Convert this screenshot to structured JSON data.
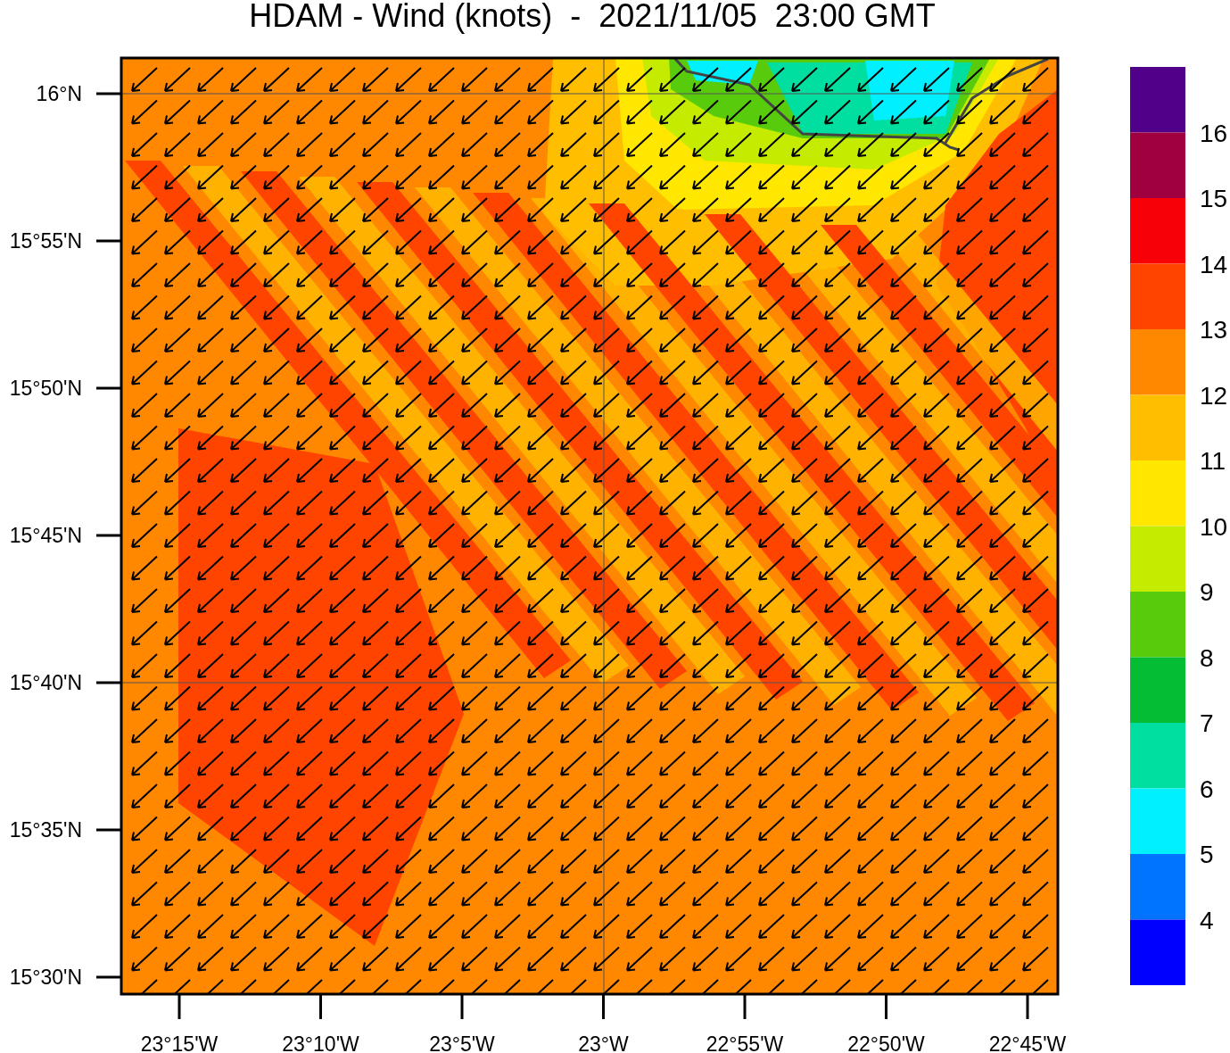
{
  "title": "HDAM - Wind (knots)  -  2021/11/05  23:00 GMT",
  "y_axis": {
    "ticks": [
      "16°N",
      "15°55'N",
      "15°50'N",
      "15°45'N",
      "15°40'N",
      "15°35'N",
      "15°30'N"
    ]
  },
  "x_axis": {
    "ticks": [
      "23°15'W",
      "23°10'W",
      "23°5'W",
      "23°W",
      "22°55'W",
      "22°50'W",
      "22°45'W"
    ]
  },
  "colorbar": {
    "swatches": [
      {
        "color": "#51008a"
      },
      {
        "color": "#a00040"
      },
      {
        "color": "#f70007"
      },
      {
        "color": "#ff4400"
      },
      {
        "color": "#ff8800"
      },
      {
        "color": "#ffbe00"
      },
      {
        "color": "#ffe700"
      },
      {
        "color": "#c5ec00"
      },
      {
        "color": "#58cc0c"
      },
      {
        "color": "#05bd35"
      },
      {
        "color": "#00dfa0"
      },
      {
        "color": "#00f0ff"
      },
      {
        "color": "#0073ff"
      },
      {
        "color": "#0000ff"
      }
    ],
    "labels": [
      "16",
      "15",
      "14",
      "13",
      "12",
      "11",
      "10",
      "9",
      "8",
      "7",
      "6",
      "5",
      "4"
    ]
  }
}
